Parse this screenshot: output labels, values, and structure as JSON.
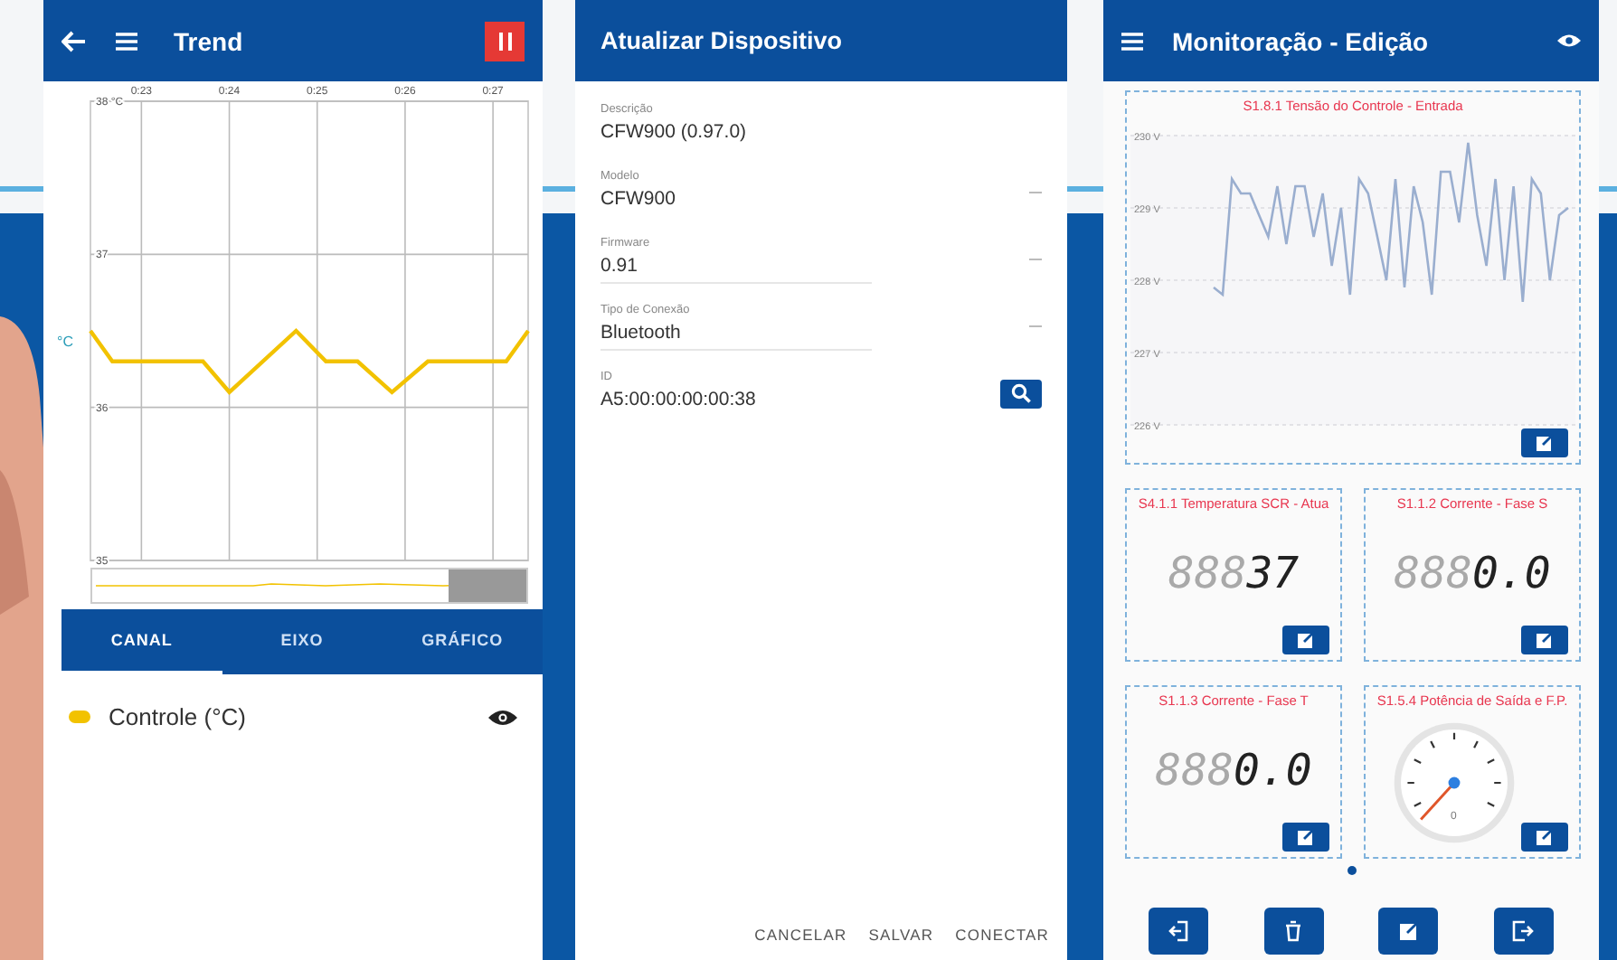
{
  "trend_screen": {
    "title": "Trend",
    "chart_data": {
      "type": "line",
      "grid": true,
      "ylabel": "°C",
      "xlim": [
        22.42,
        27.4
      ],
      "ylim": [
        35,
        38
      ],
      "xticks": [
        {
          "value": 23,
          "label": "0:23"
        },
        {
          "value": 24,
          "label": "0:24"
        },
        {
          "value": 25,
          "label": "0:25"
        },
        {
          "value": 26,
          "label": "0:26"
        },
        {
          "value": 27,
          "label": "0:27"
        }
      ],
      "yticks": [
        {
          "value": 38,
          "label": "38 °C"
        },
        {
          "value": 37,
          "label": "37"
        },
        {
          "value": 36,
          "label": "36"
        },
        {
          "value": 35,
          "label": "35"
        }
      ],
      "x": [
        22.42,
        22.67,
        23.7,
        24.0,
        24.76,
        25.1,
        25.46,
        25.85,
        26.26,
        27.15,
        27.4
      ],
      "series": [
        {
          "color": "#f2c200",
          "values": [
            36.5,
            36.3,
            36.3,
            36.1,
            36.5,
            36.3,
            36.3,
            36.1,
            36.3,
            36.3,
            36.5
          ]
        }
      ]
    },
    "tabs": [
      {
        "label": "CANAL",
        "selected": true
      },
      {
        "label": "EIXO",
        "selected": false
      },
      {
        "label": "GRÁFICO",
        "selected": false
      }
    ],
    "channels": [
      {
        "name": "Controle (°C)",
        "color": "#f2c200",
        "visible": true
      }
    ]
  },
  "device_screen": {
    "title": "Atualizar Dispositivo",
    "fields": [
      {
        "label": "Descrição",
        "value": "CFW900 (0.97.0)",
        "kind": "text"
      },
      {
        "label": "Modelo",
        "value": "CFW900",
        "kind": "dropdown"
      },
      {
        "label": "Firmware",
        "value": "0.91",
        "kind": "dropdown"
      },
      {
        "label": "Tipo de Conexão",
        "value": "Bluetooth",
        "kind": "dropdown"
      },
      {
        "label": "ID",
        "value": "A5:00:00:00:00:38",
        "kind": "search"
      }
    ],
    "buttons": [
      "CANCELAR",
      "SALVAR",
      "CONECTAR"
    ]
  },
  "monitor_screen": {
    "title": "Monitoração - Edição",
    "cards": [
      {
        "kind": "chart",
        "title": "S1.8.1 Tensão do Controle - Entrada",
        "chart_data": {
          "type": "line",
          "grid": true,
          "ylim": [
            226,
            230
          ],
          "yticks": [
            {
              "value": 230,
              "label": "230 V"
            },
            {
              "value": 229,
              "label": "229 V"
            },
            {
              "value": 228,
              "label": "228 V"
            },
            {
              "value": 227,
              "label": "227 V"
            },
            {
              "value": 226,
              "label": "226 V"
            }
          ],
          "series": [
            {
              "color": "#9aaecf",
              "values": [
                227.9,
                227.8,
                229.4,
                229.2,
                229.2,
                228.9,
                228.6,
                229.3,
                228.5,
                229.3,
                229.3,
                228.6,
                229.2,
                228.2,
                229.0,
                227.8,
                229.4,
                229.2,
                228.6,
                228.0,
                229.4,
                227.9,
                229.3,
                228.8,
                227.8,
                229.5,
                229.5,
                228.8,
                229.9,
                228.9,
                228.2,
                229.4,
                228.0,
                229.3,
                227.7,
                229.4,
                229.2,
                228.0,
                228.9,
                229.0
              ]
            }
          ]
        }
      },
      {
        "kind": "digital",
        "title": "S4.1.1 Temperatura SCR - Atua",
        "ghost": "888",
        "value": "37"
      },
      {
        "kind": "digital",
        "title": "S1.1.2 Corrente - Fase S",
        "ghost": "888",
        "value": "0.0"
      },
      {
        "kind": "digital",
        "title": "S1.1.3 Corrente - Fase T",
        "ghost": "888",
        "value": "0.0"
      },
      {
        "kind": "gauge",
        "title": "S1.5.4 Potência de Saída e F.P.",
        "scale_label": "0"
      }
    ],
    "toolbar": [
      {
        "kind": "import"
      },
      {
        "kind": "delete"
      },
      {
        "kind": "edit"
      },
      {
        "kind": "export"
      }
    ]
  }
}
